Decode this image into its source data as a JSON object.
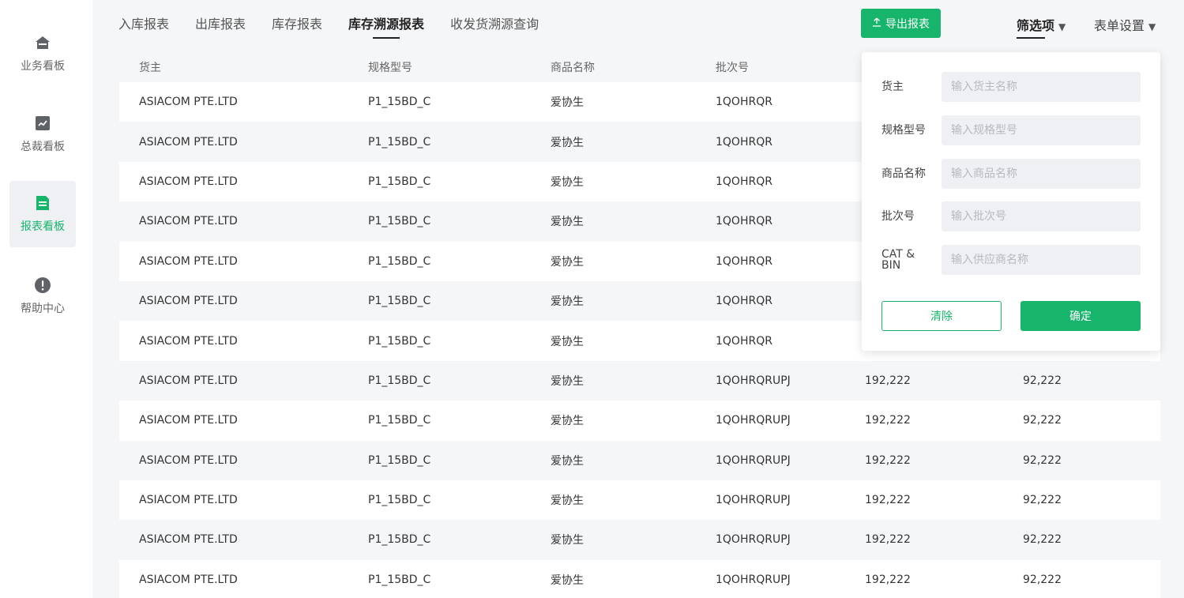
{
  "sidebar": {
    "items": [
      {
        "label": "业务看板",
        "icon": "home-icon"
      },
      {
        "label": "总裁看板",
        "icon": "trend-chart-icon"
      },
      {
        "label": "报表看板",
        "icon": "report-icon",
        "active": true
      },
      {
        "label": "帮助中心",
        "icon": "help-icon"
      }
    ]
  },
  "header": {
    "tabs": [
      "入库报表",
      "出库报表",
      "库存报表",
      "库存溯源报表",
      "收发货溯源查询"
    ],
    "active_tab": "库存溯源报表",
    "export_label": "导出报表",
    "filter_label": "筛选项",
    "settings_label": "表单设置"
  },
  "table": {
    "columns": [
      "货主",
      "规格型号",
      "商品名称",
      "批次号",
      "",
      ""
    ],
    "rows": [
      [
        "ASIACOM PTE.LTD",
        "P1_15BD_C",
        "爱协生",
        "1QOHRQR",
        "",
        ""
      ],
      [
        "ASIACOM PTE.LTD",
        "P1_15BD_C",
        "爱协生",
        "1QOHRQR",
        "",
        ""
      ],
      [
        "ASIACOM PTE.LTD",
        "P1_15BD_C",
        "爱协生",
        "1QOHRQR",
        "",
        ""
      ],
      [
        "ASIACOM PTE.LTD",
        "P1_15BD_C",
        "爱协生",
        "1QOHRQR",
        "",
        ""
      ],
      [
        "ASIACOM PTE.LTD",
        "P1_15BD_C",
        "爱协生",
        "1QOHRQR",
        "",
        ""
      ],
      [
        "ASIACOM PTE.LTD",
        "P1_15BD_C",
        "爱协生",
        "1QOHRQR",
        "",
        ""
      ],
      [
        "ASIACOM PTE.LTD",
        "P1_15BD_C",
        "爱协生",
        "1QOHRQR",
        "",
        ""
      ],
      [
        "ASIACOM PTE.LTD",
        "P1_15BD_C",
        "爱协生",
        "1QOHRQRUPJ",
        "192,222",
        "92,222"
      ],
      [
        "ASIACOM PTE.LTD",
        "P1_15BD_C",
        "爱协生",
        "1QOHRQRUPJ",
        "192,222",
        "92,222"
      ],
      [
        "ASIACOM PTE.LTD",
        "P1_15BD_C",
        "爱协生",
        "1QOHRQRUPJ",
        "192,222",
        "92,222"
      ],
      [
        "ASIACOM PTE.LTD",
        "P1_15BD_C",
        "爱协生",
        "1QOHRQRUPJ",
        "192,222",
        "92,222"
      ],
      [
        "ASIACOM PTE.LTD",
        "P1_15BD_C",
        "爱协生",
        "1QOHRQRUPJ",
        "192,222",
        "92,222"
      ],
      [
        "ASIACOM PTE.LTD",
        "P1_15BD_C",
        "爱协生",
        "1QOHRQRUPJ",
        "192,222",
        "92,222"
      ]
    ]
  },
  "filter": {
    "fields": [
      {
        "label": "货主",
        "placeholder": "输入货主名称"
      },
      {
        "label": "规格型号",
        "placeholder": "输入规格型号"
      },
      {
        "label": "商品名称",
        "placeholder": "输入商品名称"
      },
      {
        "label": "批次号",
        "placeholder": "输入批次号"
      },
      {
        "label": "CAT & BIN",
        "placeholder": "输入供应商名称"
      }
    ],
    "clear_label": "清除",
    "confirm_label": "确定"
  },
  "colors": {
    "accent": "#16b56b",
    "background": "#f5f6f8",
    "sidebar_icon": "#5f6368"
  }
}
